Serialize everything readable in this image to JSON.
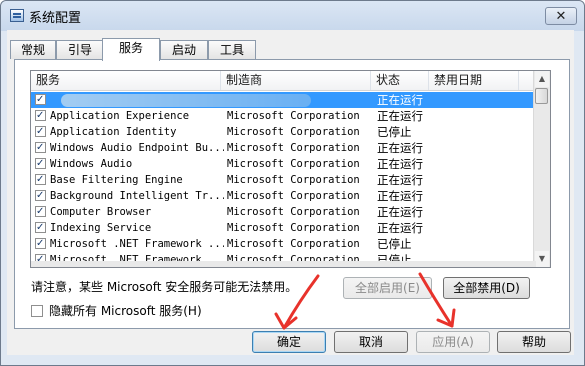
{
  "window": {
    "title": "系统配置",
    "close": "✕"
  },
  "tabs": [
    "常规",
    "引导",
    "服务",
    "启动",
    "工具"
  ],
  "active_tab": 2,
  "columns": [
    "服务",
    "制造商",
    "状态",
    "禁用日期"
  ],
  "services": [
    {
      "name": "",
      "maker": "",
      "status": "正在运行",
      "selected": true
    },
    {
      "name": "Application Experience",
      "maker": "Microsoft Corporation",
      "status": "正在运行"
    },
    {
      "name": "Application Identity",
      "maker": "Microsoft Corporation",
      "status": "已停止"
    },
    {
      "name": "Windows Audio Endpoint Bu...",
      "maker": "Microsoft Corporation",
      "status": "正在运行"
    },
    {
      "name": "Windows Audio",
      "maker": "Microsoft Corporation",
      "status": "正在运行"
    },
    {
      "name": "Base Filtering Engine",
      "maker": "Microsoft Corporation",
      "status": "正在运行"
    },
    {
      "name": "Background Intelligent Tr...",
      "maker": "Microsoft Corporation",
      "status": "正在运行"
    },
    {
      "name": "Computer Browser",
      "maker": "Microsoft Corporation",
      "status": "正在运行"
    },
    {
      "name": "Indexing Service",
      "maker": "Microsoft Corporation",
      "status": "正在运行"
    },
    {
      "name": "Microsoft .NET Framework ...",
      "maker": "Microsoft Corporation",
      "status": "已停止"
    },
    {
      "name": "Microsoft .NET Framework ...",
      "maker": "Microsoft Corporation",
      "status": "已停止"
    }
  ],
  "note": "请注意，某些 Microsoft 安全服务可能无法禁用。",
  "buttons": {
    "enable_all": "全部启用(E)",
    "disable_all": "全部禁用(D)",
    "ok": "确定",
    "cancel": "取消",
    "apply": "应用(A)",
    "help": "帮助"
  },
  "hide_ms": "隐藏所有 Microsoft 服务(H)",
  "annotation_color": "#e8322b"
}
